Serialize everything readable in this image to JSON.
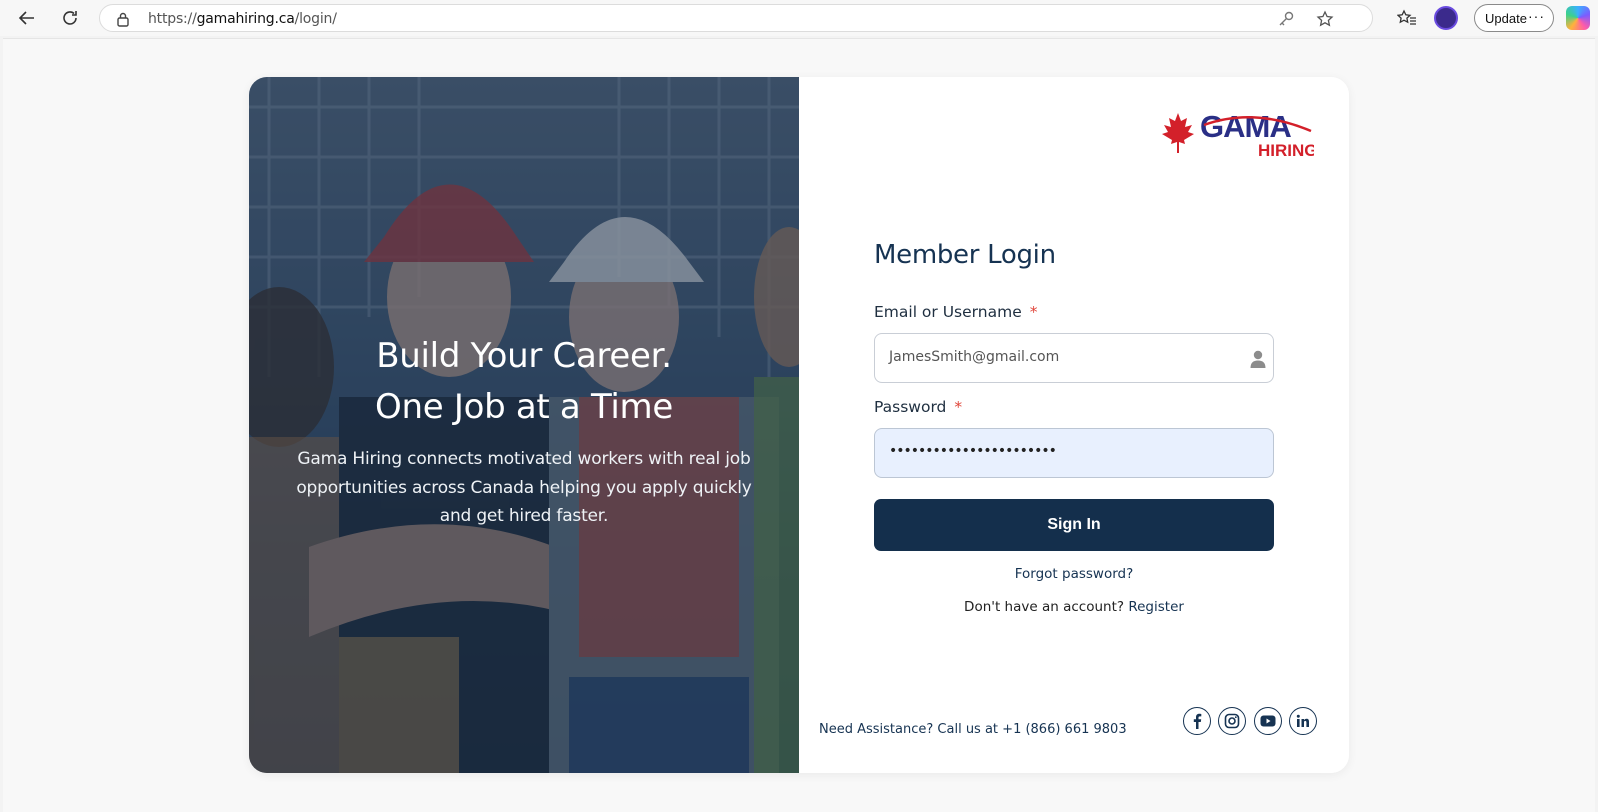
{
  "browser": {
    "url_prefix": "https://",
    "url_domain": "gamahiring.ca",
    "url_path": "/login/",
    "update_label": "Update",
    "more_label": "···"
  },
  "hero": {
    "title_line1": "Build Your Career.",
    "title_line2": "One Job at a Time",
    "description": "Gama Hiring connects motivated workers with real job opportunities across Canada helping you apply quickly and get hired faster."
  },
  "logo": {
    "brand": "GAMA",
    "sub": "HIRING",
    "colors": {
      "brand": "#2a2f86",
      "sub": "#d3202a",
      "leaf": "#d3202a"
    }
  },
  "login": {
    "title": "Member Login",
    "email_label": "Email or Username",
    "email_value": "JamesSmith@gmail.com",
    "password_label": "Password",
    "password_value": "•••••••••••••••••••••••",
    "required_mark": "*",
    "signin_label": "Sign In",
    "forgot_label": "Forgot password?",
    "no_account_text": "Don't have an account?",
    "register_label": "Register"
  },
  "footer": {
    "assist_lead": "Need Assistance?",
    "assist_text": "Call us at",
    "phone": "+1 (866) 661 9803",
    "social": [
      "facebook-icon",
      "instagram-icon",
      "youtube-icon",
      "linkedin-icon"
    ]
  },
  "colors": {
    "primary": "#142f4c",
    "required": "#e0453a",
    "autofill": "#e8f0fe"
  }
}
